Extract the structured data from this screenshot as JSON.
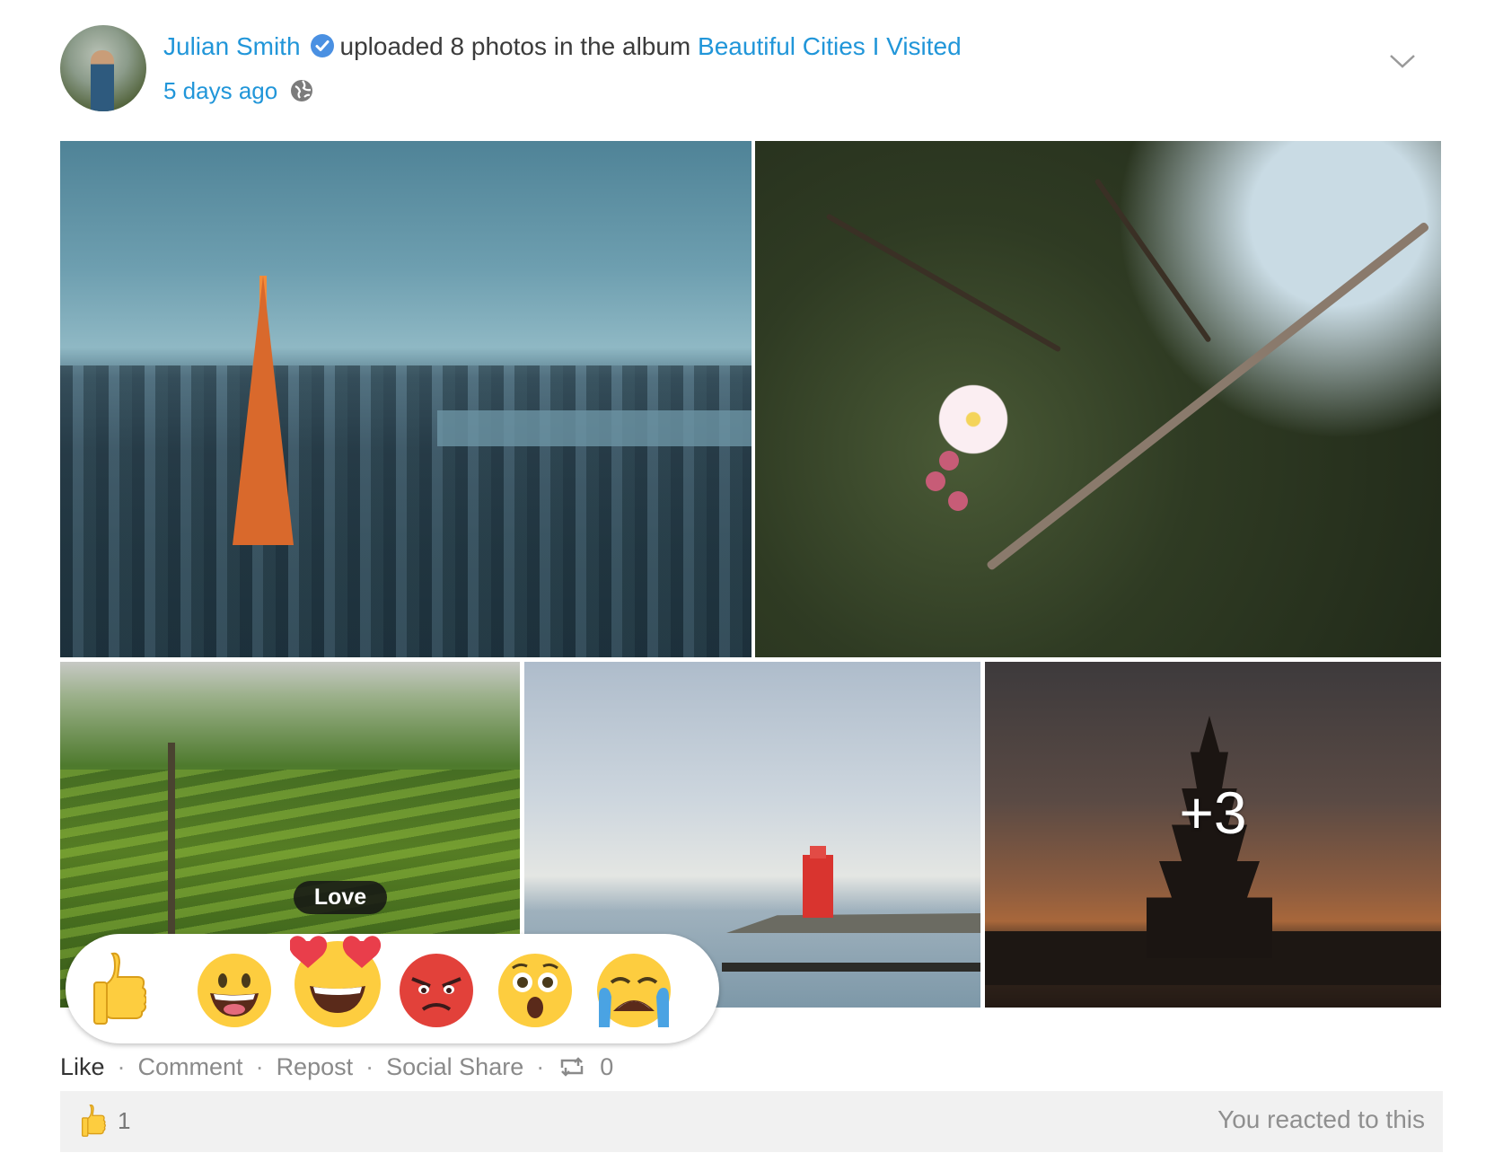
{
  "post": {
    "author": "Julian Smith",
    "action_text": "uploaded 8 photos in the album",
    "album_name": "Beautiful Cities I Visited",
    "timestamp": "5 days ago",
    "privacy_icon": "globe-icon",
    "verified_icon": "verified-badge-icon",
    "menu_icon": "chevron-down-icon"
  },
  "photos": {
    "count_uploaded": 8,
    "visible_count": 5,
    "more_label": "+3",
    "items": [
      {
        "subject": "city skyline with orange tower"
      },
      {
        "subject": "plum blossom on branch"
      },
      {
        "subject": "rice terraces with palm trees"
      },
      {
        "subject": "red lighthouse on pier"
      },
      {
        "subject": "pagoda temple silhouette at dusk"
      }
    ]
  },
  "reactions": {
    "hover_tooltip": "Love",
    "options": [
      "like",
      "love",
      "angry",
      "wow",
      "sad",
      "laugh"
    ]
  },
  "actions": {
    "like": "Like",
    "comment": "Comment",
    "repost": "Repost",
    "share": "Social Share",
    "separator": "·",
    "repost_count": "0"
  },
  "summary": {
    "like_count": "1",
    "reacted_text": "You reacted to this"
  },
  "colors": {
    "link": "#2196d9",
    "summary_bg": "#f1f1f1",
    "emoji_yellow": "#fdcd3f",
    "angry_red": "#e2413a"
  }
}
